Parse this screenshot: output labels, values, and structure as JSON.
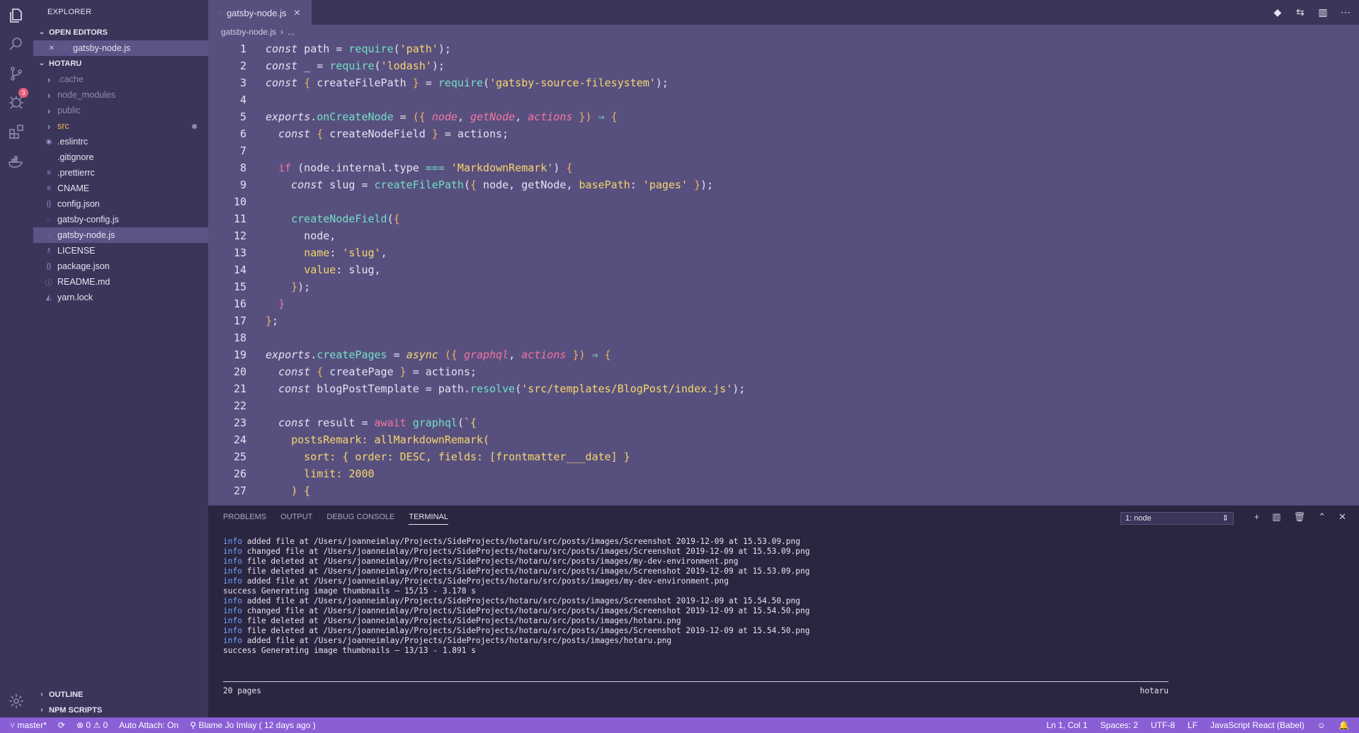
{
  "colors": {
    "activity_bg": "#3b355a",
    "editor_bg": "#57507f",
    "panel_bg": "#2b2640",
    "statusbar_bg": "#8a5fd6",
    "string": "#f8d66d",
    "function": "#74dfc4",
    "param": "#f6749e",
    "info": "#6ba6ff"
  },
  "activity": {
    "badge": "3",
    "icons": [
      "files-icon",
      "search-icon",
      "source-control-icon",
      "debug-icon",
      "extensions-icon",
      "docker-icon",
      "settings-icon"
    ]
  },
  "sidebar": {
    "title": "EXPLORER",
    "open_editors_label": "OPEN EDITORS",
    "open_editor_file": "gatsby-node.js",
    "project_label": "HOTARU",
    "items": [
      {
        "label": ".cache",
        "kind": "folder",
        "dim": true
      },
      {
        "label": "node_modules",
        "kind": "folder",
        "dim": true
      },
      {
        "label": "public",
        "kind": "folder",
        "dim": true
      },
      {
        "label": "src",
        "kind": "folder",
        "dim": false
      },
      {
        "label": ".eslintrc",
        "kind": "file",
        "icon": "◉"
      },
      {
        "label": ".gitignore",
        "kind": "file",
        "icon": ""
      },
      {
        "label": ".prettierrc",
        "kind": "file",
        "icon": "≡"
      },
      {
        "label": "CNAME",
        "kind": "file",
        "icon": "≡"
      },
      {
        "label": "config.json",
        "kind": "file",
        "icon": "{}"
      },
      {
        "label": "gatsby-config.js",
        "kind": "file",
        "icon": "◌"
      },
      {
        "label": "gatsby-node.js",
        "kind": "file",
        "icon": "◌"
      },
      {
        "label": "LICENSE",
        "kind": "file",
        "icon": "♗"
      },
      {
        "label": "package.json",
        "kind": "file",
        "icon": "{}"
      },
      {
        "label": "README.md",
        "kind": "file",
        "icon": "ⓘ"
      },
      {
        "label": "yarn.lock",
        "kind": "file",
        "icon": "◭"
      }
    ],
    "outline_label": "OUTLINE",
    "npm_label": "NPM SCRIPTS"
  },
  "editor": {
    "tab_label": "gatsby-node.js",
    "breadcrumb_file": "gatsby-node.js",
    "breadcrumb_more": "...",
    "line_numbers": [
      "1",
      "2",
      "3",
      "4",
      "5",
      "6",
      "7",
      "8",
      "9",
      "10",
      "11",
      "12",
      "13",
      "14",
      "15",
      "16",
      "17",
      "18",
      "19",
      "20",
      "21",
      "22",
      "23",
      "24",
      "25",
      "26",
      "27"
    ]
  },
  "panel": {
    "tabs": [
      "PROBLEMS",
      "OUTPUT",
      "DEBUG CONSOLE",
      "TERMINAL"
    ],
    "active_tab": "TERMINAL",
    "terminal_select": "1: node",
    "lines": [
      {
        "level": "info",
        "text": " added file at /Users/joanneimlay/Projects/SideProjects/hotaru/src/posts/images/Screenshot 2019-12-09 at 15.53.09.png"
      },
      {
        "level": "info",
        "text": " changed file at /Users/joanneimlay/Projects/SideProjects/hotaru/src/posts/images/Screenshot 2019-12-09 at 15.53.09.png"
      },
      {
        "level": "info",
        "text": " file deleted at /Users/joanneimlay/Projects/SideProjects/hotaru/src/posts/images/my-dev-environment.png"
      },
      {
        "level": "info",
        "text": " file deleted at /Users/joanneimlay/Projects/SideProjects/hotaru/src/posts/images/Screenshot 2019-12-09 at 15.53.09.png"
      },
      {
        "level": "info",
        "text": " added file at /Users/joanneimlay/Projects/SideProjects/hotaru/src/posts/images/my-dev-environment.png"
      },
      {
        "level": "success",
        "text": "success Generating image thumbnails — 15/15 - 3.178 s"
      },
      {
        "level": "info",
        "text": " added file at /Users/joanneimlay/Projects/SideProjects/hotaru/src/posts/images/Screenshot 2019-12-09 at 15.54.50.png"
      },
      {
        "level": "info",
        "text": " changed file at /Users/joanneimlay/Projects/SideProjects/hotaru/src/posts/images/Screenshot 2019-12-09 at 15.54.50.png"
      },
      {
        "level": "info",
        "text": " file deleted at /Users/joanneimlay/Projects/SideProjects/hotaru/src/posts/images/hotaru.png"
      },
      {
        "level": "info",
        "text": " file deleted at /Users/joanneimlay/Projects/SideProjects/hotaru/src/posts/images/Screenshot 2019-12-09 at 15.54.50.png"
      },
      {
        "level": "info",
        "text": " added file at /Users/joanneimlay/Projects/SideProjects/hotaru/src/posts/images/hotaru.png"
      },
      {
        "level": "success",
        "text": "success Generating image thumbnails — 13/13 - 1.891 s"
      }
    ],
    "info_word": "info",
    "pages": "20 pages",
    "host": "hotaru"
  },
  "statusbar": {
    "branch": "master*",
    "problems": "⊗ 0 ⚠ 0",
    "auto_attach": "Auto Attach: On",
    "blame": "Blame Jo Imlay ( 12 days ago )",
    "position": "Ln 1, Col 1",
    "spaces": "Spaces: 2",
    "encoding": "UTF-8",
    "eol": "LF",
    "language": "JavaScript React (Babel)"
  }
}
